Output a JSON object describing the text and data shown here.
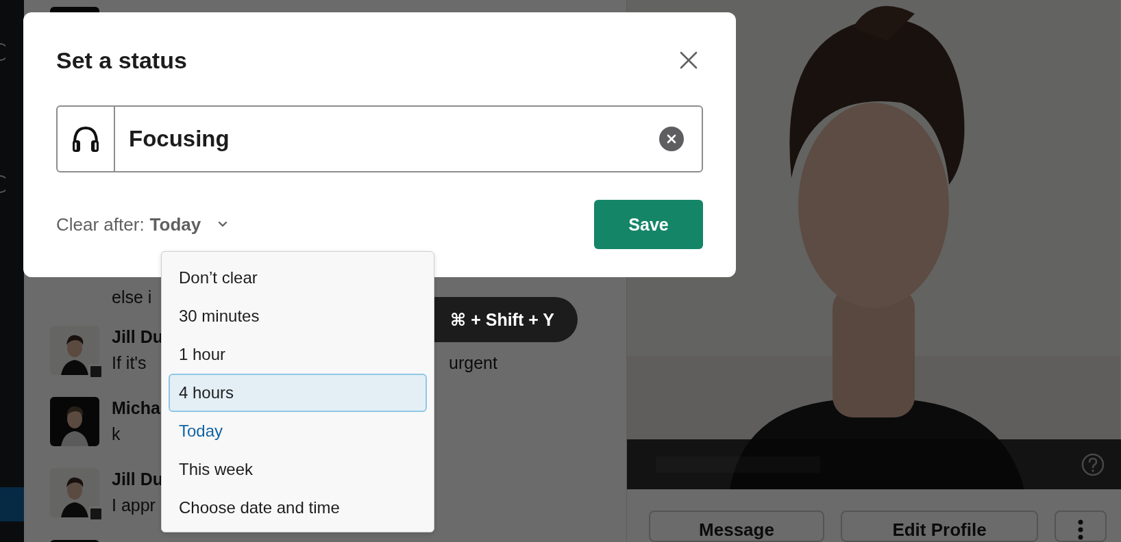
{
  "sidebar": {
    "items": [
      {
        "kind": "icon",
        "selected": false
      },
      {
        "kind": "icon",
        "selected": false
      },
      {
        "kind": "row",
        "selected": true
      }
    ]
  },
  "messages": [
    {
      "kind": "avatar_only",
      "dark_avatar": true,
      "away": false
    },
    {
      "kind": "continuation",
      "text_parts": [
        "else i"
      ]
    },
    {
      "kind": "message",
      "dark_avatar": false,
      "away": true,
      "author": "Jill Du",
      "text_parts": [
        "If it's",
        "urgent"
      ]
    },
    {
      "kind": "message",
      "dark_avatar": true,
      "away": false,
      "author": "Micha",
      "text_parts": [
        "k"
      ]
    },
    {
      "kind": "message",
      "dark_avatar": false,
      "away": true,
      "author": "Jill Du",
      "text_parts": [
        "I appr"
      ]
    },
    {
      "kind": "avatar_only",
      "dark_avatar": true,
      "away": false
    }
  ],
  "profile": {
    "buttons": [
      {
        "kind": "text",
        "label": "Message"
      },
      {
        "kind": "text",
        "label": "Edit Profile"
      },
      {
        "kind": "more"
      }
    ]
  },
  "shortcut_tooltip": {
    "text": "⌘ + Shift + Y"
  },
  "dialog": {
    "title": "Set a status",
    "status_field": {
      "value": "Focusing"
    },
    "clear_after": {
      "label": "Clear after:",
      "value": "Today",
      "options": [
        {
          "label": "Don’t clear",
          "highlighted": false,
          "selected": false
        },
        {
          "label": "30 minutes",
          "highlighted": false,
          "selected": false
        },
        {
          "label": "1 hour",
          "highlighted": false,
          "selected": false
        },
        {
          "label": "4 hours",
          "highlighted": true,
          "selected": false
        },
        {
          "label": "Today",
          "highlighted": false,
          "selected": true
        },
        {
          "label": "This week",
          "highlighted": false,
          "selected": false
        },
        {
          "label": "Choose date and time",
          "highlighted": false,
          "selected": false
        }
      ]
    },
    "save_button": "Save"
  }
}
